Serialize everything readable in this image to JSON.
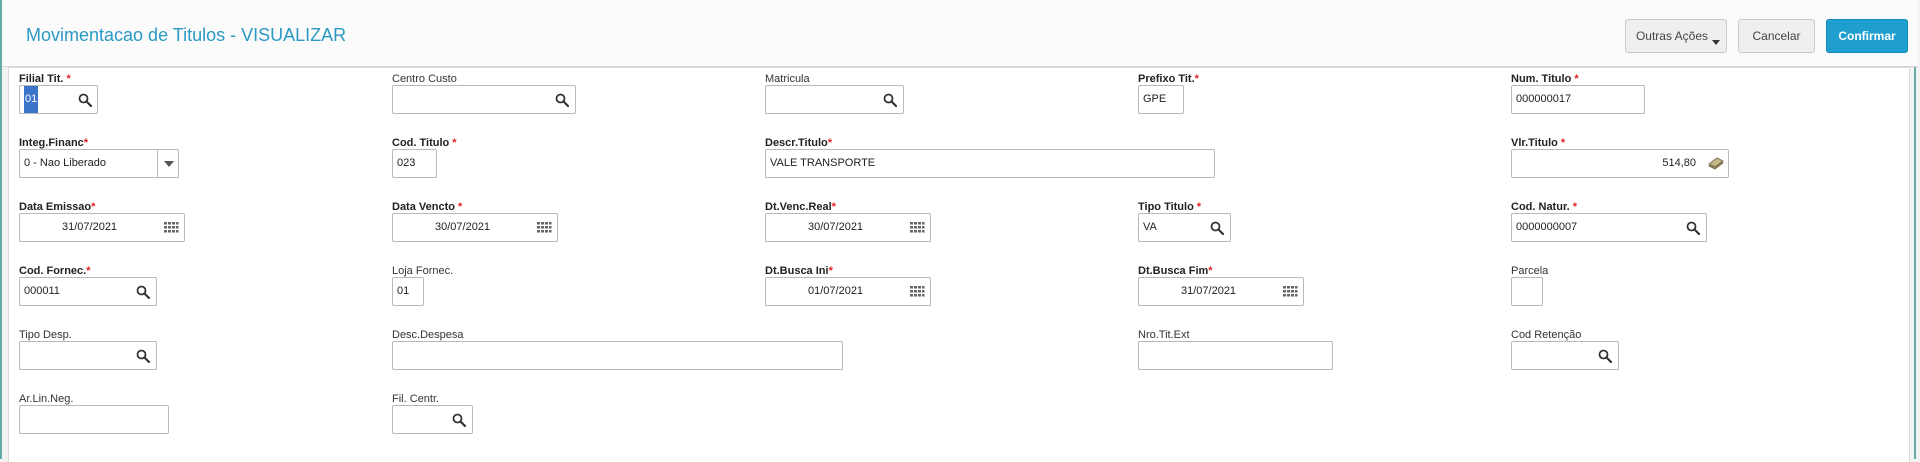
{
  "header": {
    "title": "Movimentacao de Titulos - VISUALIZAR",
    "outras_acoes": "Outras Ações",
    "cancelar": "Cancelar",
    "confirmar": "Confirmar"
  },
  "fields": {
    "filial": {
      "label": "Filial Tit.",
      "value": "01"
    },
    "centro_custo": {
      "label": "Centro Custo",
      "value": ""
    },
    "matricula": {
      "label": "Matricula",
      "value": ""
    },
    "prefixo": {
      "label": "Prefixo Tit.",
      "value": "GPE"
    },
    "num_titulo": {
      "label": "Num. Titulo",
      "value": "000000017"
    },
    "integ_financ": {
      "label": "Integ.Financ",
      "value": "0 - Nao Liberado"
    },
    "cod_titulo": {
      "label": "Cod. Titulo",
      "value": "023"
    },
    "descr_titulo": {
      "label": "Descr.Titulo",
      "value": "VALE TRANSPORTE"
    },
    "vlr_titulo": {
      "label": "Vlr.Titulo",
      "value": "514,80"
    },
    "data_emissao": {
      "label": "Data Emissao",
      "value": "31/07/2021"
    },
    "data_vencto": {
      "label": "Data Vencto",
      "value": "30/07/2021"
    },
    "dt_venc_real": {
      "label": "Dt.Venc.Real",
      "value": "30/07/2021"
    },
    "tipo_titulo": {
      "label": "Tipo Titulo",
      "value": "VA"
    },
    "cod_natur": {
      "label": "Cod. Natur.",
      "value": "0000000007"
    },
    "cod_fornec": {
      "label": "Cod. Fornec.",
      "value": "000011"
    },
    "loja_fornec": {
      "label": "Loja Fornec.",
      "value": "01"
    },
    "dt_busca_ini": {
      "label": "Dt.Busca Ini",
      "value": "01/07/2021"
    },
    "dt_busca_fim": {
      "label": "Dt.Busca Fim",
      "value": "31/07/2021"
    },
    "parcela": {
      "label": "Parcela",
      "value": ""
    },
    "tipo_desp": {
      "label": "Tipo Desp.",
      "value": ""
    },
    "desc_despesa": {
      "label": "Desc.Despesa",
      "value": ""
    },
    "nro_tit_ext": {
      "label": "Nro.Tit.Ext",
      "value": ""
    },
    "cod_retencao": {
      "label": "Cod Retenção",
      "value": ""
    },
    "ar_lin_neg": {
      "label": "Ar.Lin.Neg.",
      "value": ""
    },
    "fil_centr": {
      "label": "Fil. Centr.",
      "value": ""
    }
  },
  "colors": {
    "accent": "#2b99c4",
    "primary_button": "#1f9fcf",
    "required": "#e02020"
  }
}
